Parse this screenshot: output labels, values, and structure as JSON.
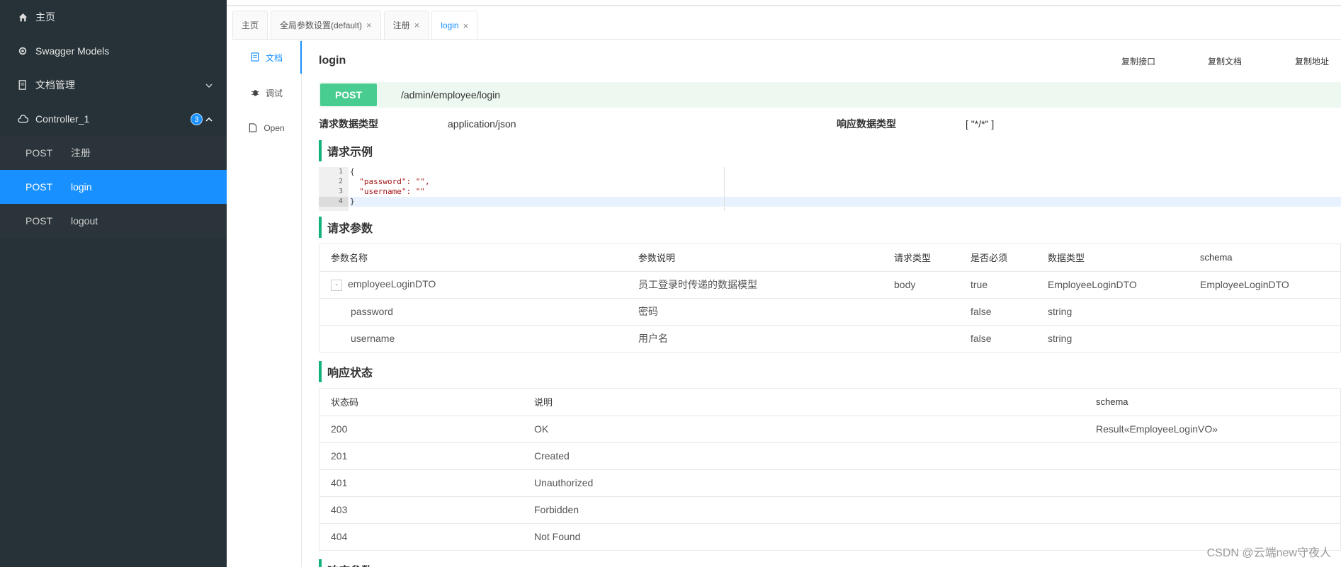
{
  "sidebar": {
    "home": "主页",
    "models": "Swagger Models",
    "docs": "文档管理",
    "controller": "Controller_1",
    "controller_badge": "3",
    "items": [
      {
        "method": "POST",
        "name": "注册"
      },
      {
        "method": "POST",
        "name": "login"
      },
      {
        "method": "POST",
        "name": "logout"
      }
    ]
  },
  "tabs": [
    {
      "label": "主页"
    },
    {
      "label": "全局参数设置(default)"
    },
    {
      "label": "注册"
    },
    {
      "label": "login"
    }
  ],
  "subnav": {
    "doc": "文档",
    "debug": "调试",
    "open": "Open"
  },
  "api": {
    "title": "login",
    "copy_api": "复制接口",
    "copy_doc": "复制文档",
    "copy_addr": "复制地址",
    "method": "POST",
    "path": "/admin/employee/login",
    "req_type_label": "请求数据类型",
    "req_type": "application/json",
    "resp_type_label": "响应数据类型",
    "resp_type": "[ \"*/*\" ]"
  },
  "sections": {
    "example": "请求示例",
    "params": "请求参数",
    "status": "响应状态",
    "resp_params": "响应参数"
  },
  "code": {
    "lines": [
      "{",
      "  \"password\": \"\",",
      "  \"username\": \"\"",
      "}"
    ]
  },
  "params_table": {
    "headers": [
      "参数名称",
      "参数说明",
      "请求类型",
      "是否必须",
      "数据类型",
      "schema"
    ],
    "rows": [
      {
        "name": "employeeLoginDTO",
        "desc": "员工登录时传递的数据模型",
        "in": "body",
        "required": "true",
        "type": "EmployeeLoginDTO",
        "schema": "EmployeeLoginDTO"
      },
      {
        "name": "password",
        "desc": "密码",
        "in": "",
        "required": "false",
        "type": "string",
        "schema": ""
      },
      {
        "name": "username",
        "desc": "用户名",
        "in": "",
        "required": "false",
        "type": "string",
        "schema": ""
      }
    ]
  },
  "status_table": {
    "headers": [
      "状态码",
      "说明",
      "schema"
    ],
    "rows": [
      {
        "code": "200",
        "desc": "OK",
        "schema": "Result«EmployeeLoginVO»"
      },
      {
        "code": "201",
        "desc": "Created",
        "schema": ""
      },
      {
        "code": "401",
        "desc": "Unauthorized",
        "schema": ""
      },
      {
        "code": "403",
        "desc": "Forbidden",
        "schema": ""
      },
      {
        "code": "404",
        "desc": "Not Found",
        "schema": ""
      }
    ]
  },
  "watermark": "CSDN @云端new守夜人"
}
